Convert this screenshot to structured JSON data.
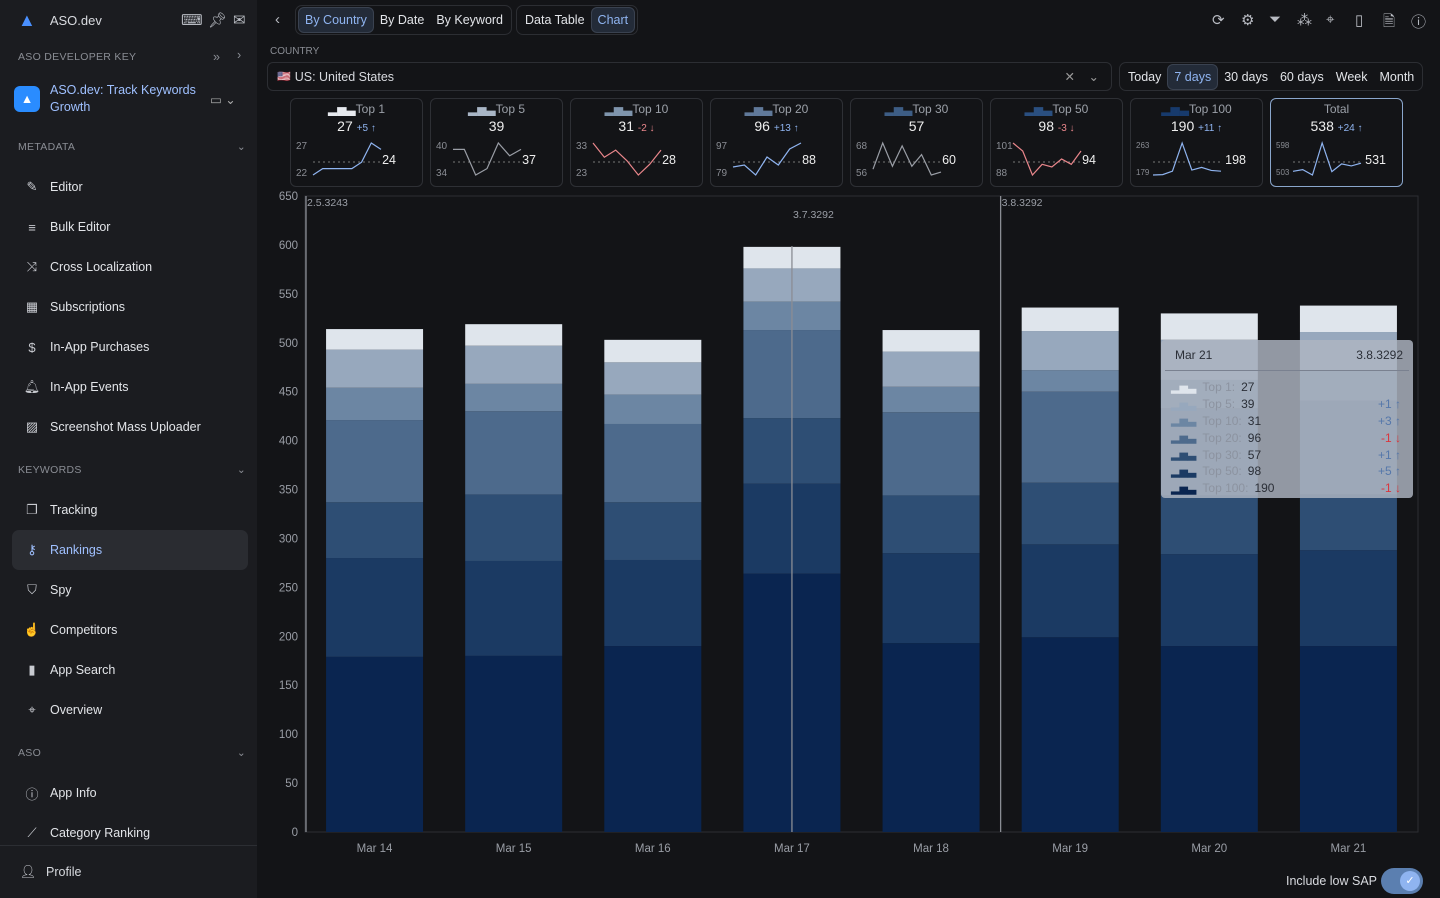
{
  "app": {
    "name": "ASO.dev",
    "dev_key_label": "ASO DEVELOPER KEY",
    "app_name": "ASO.dev: Track Keywords Growth"
  },
  "sidebar": {
    "sections": [
      {
        "label": "METADATA",
        "items": [
          {
            "label": "Editor",
            "icon": "pencil-icon"
          },
          {
            "label": "Bulk Editor",
            "icon": "bulk-edit-icon"
          },
          {
            "label": "Cross Localization",
            "icon": "shuffle-icon"
          },
          {
            "label": "Subscriptions",
            "icon": "calendar-icon"
          },
          {
            "label": "In-App Purchases",
            "icon": "dollar-icon"
          },
          {
            "label": "In-App Events",
            "icon": "bell-icon"
          },
          {
            "label": "Screenshot Mass Uploader",
            "icon": "image-upload-icon"
          }
        ]
      },
      {
        "label": "KEYWORDS",
        "items": [
          {
            "label": "Tracking",
            "icon": "copy-icon"
          },
          {
            "label": "Rankings",
            "icon": "key-icon",
            "active": true
          },
          {
            "label": "Spy",
            "icon": "shield-icon"
          },
          {
            "label": "Competitors",
            "icon": "hand-icon"
          },
          {
            "label": "App Search",
            "icon": "bars-icon"
          },
          {
            "label": "Overview",
            "icon": "scan-icon"
          }
        ]
      },
      {
        "label": "ASO",
        "items": [
          {
            "label": "App Info",
            "icon": "info-icon"
          },
          {
            "label": "Category Ranking",
            "icon": "chart-icon"
          }
        ]
      }
    ],
    "profile": "Profile"
  },
  "toolbar": {
    "view_tabs": [
      "By Country",
      "By Date",
      "By Keyword"
    ],
    "active_view": "By Country",
    "mode_tabs": [
      "Data Table",
      "Chart"
    ],
    "active_mode": "Chart",
    "icons": [
      "refresh-icon",
      "settings-icon",
      "filter-icon",
      "cluster-icon",
      "focus-icon",
      "clipboard-icon",
      "export-icon",
      "help-icon"
    ]
  },
  "country": {
    "label": "COUNTRY",
    "value": "US: United States",
    "flag": "🇺🇸"
  },
  "periods": {
    "options": [
      "Today",
      "7 days",
      "30 days",
      "60 days",
      "Week",
      "Month"
    ],
    "active": "7 days"
  },
  "cards": [
    {
      "title": "Top 1",
      "value": "27",
      "delta": "+5 ↑",
      "dir": "up",
      "max": "27",
      "min": "22",
      "last": "24",
      "color": "#8fb4f0",
      "spark": [
        22,
        23,
        23,
        23,
        23,
        24,
        27,
        26
      ]
    },
    {
      "title": "Top 5",
      "value": "39",
      "delta": "",
      "dir": "",
      "max": "40",
      "min": "34",
      "last": "37",
      "color": "#9a9ea6",
      "spark": [
        39,
        39,
        35,
        36,
        40,
        38,
        39
      ]
    },
    {
      "title": "Top 10",
      "value": "31",
      "delta": "-2 ↓",
      "dir": "dn",
      "max": "33",
      "min": "23",
      "last": "28",
      "color": "#e9868b",
      "spark": [
        33,
        29,
        31,
        28,
        24,
        27,
        31
      ]
    },
    {
      "title": "Top 20",
      "value": "96",
      "delta": "+13 ↑",
      "dir": "up",
      "max": "97",
      "min": "79",
      "last": "88",
      "color": "#8fb4f0",
      "spark": [
        84,
        85,
        80,
        89,
        85,
        93,
        96
      ]
    },
    {
      "title": "Top 30",
      "value": "57",
      "delta": "",
      "dir": "",
      "max": "68",
      "min": "56",
      "last": "60",
      "color": "#9a9ea6",
      "spark": [
        59,
        68,
        60,
        67,
        60,
        64,
        57,
        58
      ]
    },
    {
      "title": "Top 50",
      "value": "98",
      "delta": "-3 ↓",
      "dir": "dn",
      "max": "101",
      "min": "88",
      "last": "94",
      "color": "#e9868b",
      "spark": [
        101,
        98,
        89,
        93,
        92,
        95,
        93,
        98
      ]
    },
    {
      "title": "Top 100",
      "value": "190",
      "delta": "+11 ↑",
      "dir": "up",
      "max": "263",
      "min": "179",
      "last": "198",
      "color": "#8fb4f0",
      "spark": [
        180,
        181,
        190,
        264,
        193,
        200,
        192,
        190
      ]
    },
    {
      "title": "Total",
      "value": "538",
      "delta": "+24 ↑",
      "dir": "up",
      "max": "598",
      "min": "503",
      "last": "531",
      "color": "#8fb4f0",
      "spark": [
        514,
        519,
        503,
        598,
        513,
        536,
        530,
        538
      ]
    }
  ],
  "chart_data": {
    "type": "bar",
    "stacked": true,
    "categories": [
      "Mar 14",
      "Mar 15",
      "Mar 16",
      "Mar 17",
      "Mar 18",
      "Mar 19",
      "Mar 20",
      "Mar 21"
    ],
    "ylim": [
      0,
      650
    ],
    "yticks": [
      0,
      50,
      100,
      150,
      200,
      250,
      300,
      350,
      400,
      450,
      500,
      550,
      600,
      650
    ],
    "series": [
      {
        "name": "Top 100",
        "color": "#0a2550",
        "values": [
          179,
          180,
          190,
          264,
          193,
          199,
          190,
          190
        ]
      },
      {
        "name": "Top 50",
        "color": "#1b3a63",
        "values": [
          101,
          97,
          88,
          92,
          92,
          95,
          94,
          98
        ]
      },
      {
        "name": "Top 30",
        "color": "#2e4e74",
        "values": [
          57,
          68,
          59,
          67,
          59,
          63,
          60,
          57
        ]
      },
      {
        "name": "Top 20",
        "color": "#4d6a8c",
        "values": [
          84,
          85,
          80,
          90,
          85,
          93,
          89,
          96
        ]
      },
      {
        "name": "Top 10",
        "color": "#6c86a3",
        "values": [
          33,
          28,
          30,
          29,
          26,
          22,
          29,
          31
        ]
      },
      {
        "name": "Top 5",
        "color": "#97a8bd",
        "values": [
          39,
          39,
          33,
          34,
          36,
          40,
          41,
          39
        ]
      },
      {
        "name": "Top 1",
        "color": "#dfe5ec",
        "values": [
          21,
          22,
          23,
          22,
          22,
          24,
          27,
          27
        ]
      }
    ],
    "annotations": [
      {
        "label": "2.5.3243",
        "at": "Mar 14",
        "pos": "before"
      },
      {
        "label": "3.7.3292",
        "at": "Mar 17"
      },
      {
        "label": "3.8.3292",
        "at": "Mar 19",
        "pos": "before"
      }
    ],
    "tooltip": {
      "date": "Mar 21",
      "version": "3.8.3292",
      "rows": [
        {
          "label": "Top 1:",
          "value": "27",
          "delta": "",
          "dir": ""
        },
        {
          "label": "Top 5:",
          "value": "39",
          "delta": "+1 ↑",
          "dir": "up"
        },
        {
          "label": "Top 10:",
          "value": "31",
          "delta": "+3 ↑",
          "dir": "up"
        },
        {
          "label": "Top 20:",
          "value": "96",
          "delta": "-1 ↓",
          "dir": "dn"
        },
        {
          "label": "Top 30:",
          "value": "57",
          "delta": "+1 ↑",
          "dir": "up"
        },
        {
          "label": "Top 50:",
          "value": "98",
          "delta": "+5 ↑",
          "dir": "up"
        },
        {
          "label": "Top 100:",
          "value": "190",
          "delta": "-1 ↓",
          "dir": "dn"
        }
      ]
    }
  },
  "footer": {
    "toggle_label": "Include low SAP",
    "toggle_on": true
  }
}
